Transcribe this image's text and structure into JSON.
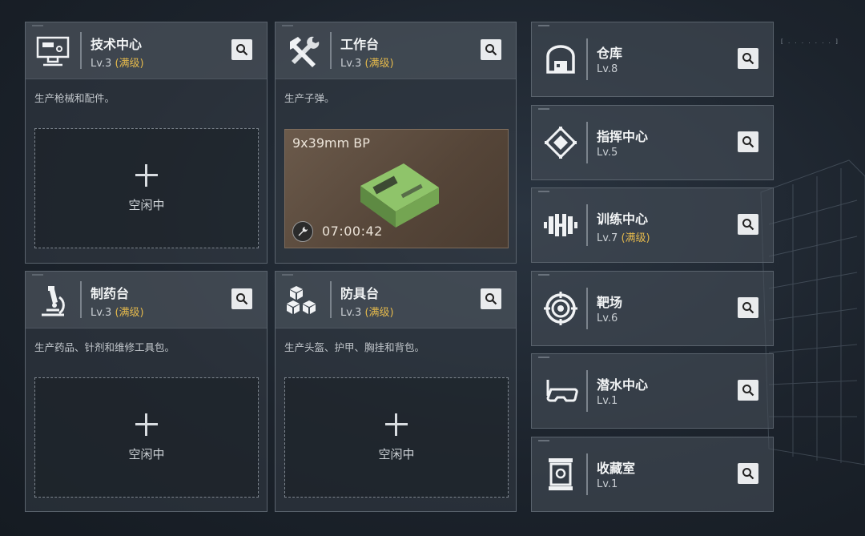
{
  "colors": {
    "max_level": "#e3b84c",
    "panel": "#343c46",
    "accent_slot": "#6b5a4b"
  },
  "corner_label": "[ . . . . . . . ]",
  "facilities": [
    {
      "name": "技术中心",
      "level": "Lv.3",
      "max_tag": "(满级)",
      "desc": "生产枪械和配件。",
      "icon": "monitor-icon",
      "slot": {
        "idle": "空闲中"
      }
    },
    {
      "name": "工作台",
      "level": "Lv.3",
      "max_tag": "(满级)",
      "desc": "生产子弹。",
      "icon": "hammer-wrench-icon",
      "craft": {
        "item": "9x39mm BP",
        "timer": "07:00:42"
      }
    },
    {
      "name": "制药台",
      "level": "Lv.3",
      "max_tag": "(满级)",
      "desc": "生产药品、针剂和维修工具包。",
      "icon": "microscope-icon",
      "slot": {
        "idle": "空闲中"
      }
    },
    {
      "name": "防具台",
      "level": "Lv.3",
      "max_tag": "(满级)",
      "desc": "生产头盔、护甲、胸挂和背包。",
      "icon": "cubes-icon",
      "slot": {
        "idle": "空闲中"
      }
    }
  ],
  "side": [
    {
      "name": "仓库",
      "level": "Lv.8",
      "max_tag": "",
      "icon": "warehouse-icon"
    },
    {
      "name": "指挥中心",
      "level": "Lv.5",
      "max_tag": "",
      "icon": "chip-icon"
    },
    {
      "name": "训练中心",
      "level": "Lv.7",
      "max_tag": "(满级)",
      "icon": "dumbbell-icon"
    },
    {
      "name": "靶场",
      "level": "Lv.6",
      "max_tag": "",
      "icon": "target-icon"
    },
    {
      "name": "潜水中心",
      "level": "Lv.1",
      "max_tag": "",
      "icon": "diving-mask-icon"
    },
    {
      "name": "收藏室",
      "level": "Lv.1",
      "max_tag": "",
      "icon": "display-case-icon"
    }
  ]
}
